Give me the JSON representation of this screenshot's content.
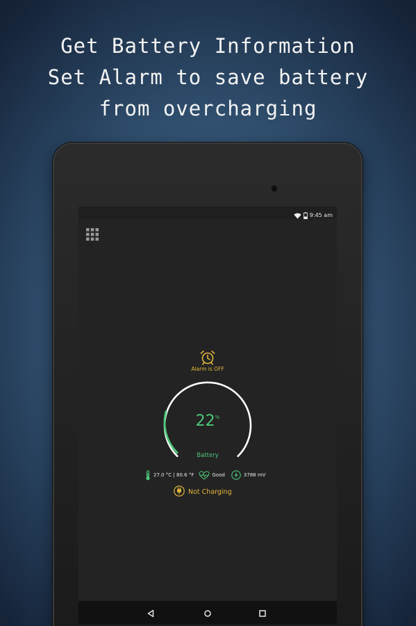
{
  "headline": {
    "line1": "Get Battery Information",
    "line2": "Set Alarm to save battery",
    "line3": "from overcharging"
  },
  "status_bar": {
    "time": "9:45 am",
    "icons": [
      "wifi-icon",
      "battery-status-icon"
    ]
  },
  "app": {
    "menu_icon": "grid-menu-icon",
    "alarm": {
      "icon": "alarm-clock-icon",
      "status": "Alarm is OFF"
    },
    "battery": {
      "level_value": "22",
      "level_unit": "%",
      "level_fraction": 0.22,
      "label": "Battery"
    },
    "info": {
      "temperature": "27.0 °C | 80.6 °F",
      "health": "Good",
      "voltage": "3788 mV"
    },
    "charging": {
      "icon": "charger-plug-icon",
      "status": "Not Charging"
    }
  },
  "nav_bar": {
    "icons": [
      "back-icon",
      "home-icon",
      "recents-icon"
    ]
  },
  "colors": {
    "accent_green": "#4dc77a",
    "accent_yellow": "#e4b63c",
    "screen_bg": "#232323",
    "gauge_track": "#ffffff"
  }
}
